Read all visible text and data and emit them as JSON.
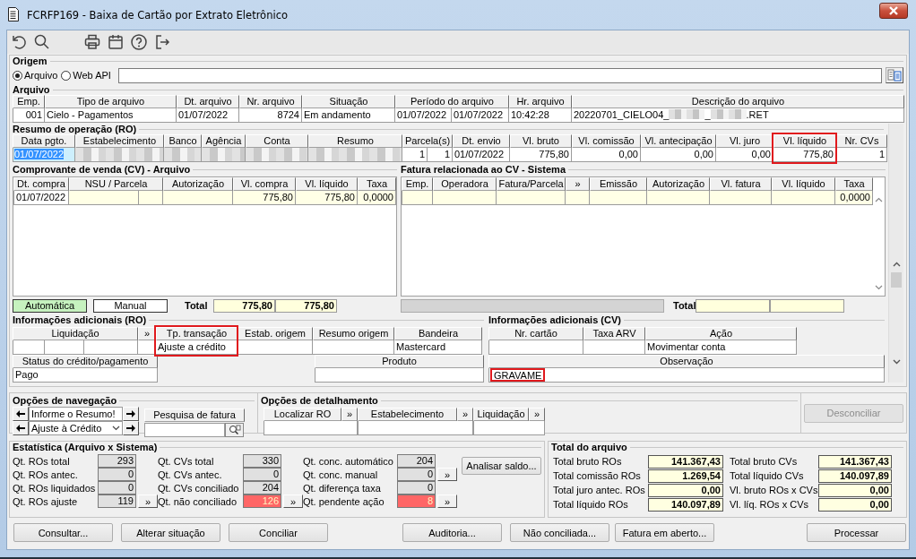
{
  "window": {
    "title": "FCRFP169 - Baixa de Cartão por Extrato Eletrônico"
  },
  "origem": {
    "title": "Origem",
    "options": [
      {
        "label": "Arquivo",
        "selected": true
      },
      {
        "label": "Web API",
        "selected": false
      }
    ]
  },
  "arquivo": {
    "title": "Arquivo",
    "columns": [
      {
        "label": "Emp."
      },
      {
        "label": "Tipo de arquivo"
      },
      {
        "label": "Dt. arquivo"
      },
      {
        "label": "Nr. arquivo"
      },
      {
        "label": "Situação"
      },
      {
        "label": "Período do arquivo"
      },
      {
        "label": "Hr. arquivo"
      },
      {
        "label": "Descrição do arquivo"
      }
    ],
    "rows": [
      [
        {
          "text": "001"
        },
        {
          "text": "Cielo - Pagamentos"
        },
        {
          "text": "01/07/2022"
        },
        {
          "text": "8724"
        },
        {
          "text": "Em andamento"
        },
        {
          "parts": [
            "01/07/2022",
            "01/07/2022"
          ]
        },
        {
          "text": "10:42:28"
        },
        {
          "segments": [
            {
              "text": "20220701_CIELO04_"
            },
            {
              "redacted": true
            },
            {
              "text": "_"
            },
            {
              "redacted": true
            },
            {
              "text": ".RET"
            }
          ]
        }
      ]
    ]
  },
  "resumo": {
    "title": "Resumo de operação (RO)",
    "columns": [
      {
        "label": "Data pgto.",
        "highlighted": false
      },
      {
        "label": "Estabelecimento",
        "highlighted": false
      },
      {
        "label": "Banco",
        "highlighted": false
      },
      {
        "label": "Agência",
        "highlighted": false
      },
      {
        "label": "Conta",
        "highlighted": false
      },
      {
        "label": "Resumo",
        "highlighted": false
      },
      {
        "label": "Parcela(s)",
        "highlighted": false
      },
      {
        "label": "Dt. envio",
        "highlighted": false
      },
      {
        "label": "Vl. bruto",
        "highlighted": false
      },
      {
        "label": "Vl. comissão",
        "highlighted": false
      },
      {
        "label": "Vl. antecipação",
        "highlighted": false
      },
      {
        "label": "Vl. juro",
        "highlighted": false
      },
      {
        "label": "Vl. líquido",
        "highlighted": true
      },
      {
        "label": "Nr. CVs",
        "highlighted": false
      }
    ],
    "rows": [
      [
        {
          "text": "01/07/2022",
          "selected": true
        },
        {
          "redacted": true
        },
        {
          "redacted": true
        },
        {
          "redacted": true
        },
        {
          "redacted": true
        },
        {
          "redacted": true
        },
        {
          "parts": [
            "1",
            "1"
          ]
        },
        {
          "text": "01/07/2022"
        },
        {
          "text": "775,80"
        },
        {
          "text": "0,00"
        },
        {
          "text": "0,00"
        },
        {
          "text": "0,00"
        },
        {
          "text": "775,80"
        },
        {
          "text": "1"
        }
      ]
    ]
  },
  "comprovante": {
    "title": "Comprovante de venda (CV) - Arquivo",
    "columns": [
      {
        "label": "Dt. compra"
      },
      {
        "label": "NSU / Parcela"
      },
      {
        "label": "Autorização"
      },
      {
        "label": "Vl. compra"
      },
      {
        "label": "Vl. líquido"
      },
      {
        "label": "Taxa"
      }
    ],
    "rows": [
      [
        {
          "text": "01/07/2022"
        },
        null,
        null,
        {
          "text": "775,80"
        },
        {
          "text": "775,80"
        },
        {
          "text": "0,0000"
        }
      ]
    ],
    "legend": [
      {
        "label": "Automática",
        "color": "#c6f2bf"
      },
      {
        "label": "Manual",
        "color": "#ffffff"
      }
    ],
    "total_label": "Total",
    "totals": [
      "775,80",
      "775,80"
    ]
  },
  "fatura": {
    "title": "Fatura relacionada ao CV - Sistema",
    "columns": [
      {
        "label": "Emp."
      },
      {
        "label": "Operadora"
      },
      {
        "label": "Fatura/Parcela"
      },
      {
        "label": "»"
      },
      {
        "label": "Emissão"
      },
      {
        "label": "Autorização"
      },
      {
        "label": "Vl. fatura"
      },
      {
        "label": "Vl. líquido"
      },
      {
        "label": "Taxa"
      }
    ],
    "rows": [
      [
        null,
        null,
        null,
        null,
        null,
        null,
        null,
        null,
        {
          "text": "0,0000"
        }
      ]
    ],
    "progress": {
      "level": 0
    },
    "total_label": "Total"
  },
  "info_ro": {
    "title": "Informações adicionais (RO)",
    "columns": [
      {
        "label": "Liquidação",
        "highlighted": false
      },
      {
        "label": "»",
        "highlighted": false
      },
      {
        "label": "Tp. transação",
        "highlighted": true
      },
      {
        "label": "Estab. origem",
        "highlighted": false
      },
      {
        "label": "Resumo origem",
        "highlighted": false
      },
      {
        "label": "Bandeira",
        "highlighted": false
      }
    ],
    "rows": [
      [
        null,
        null,
        {
          "text": "Ajuste a crédito"
        },
        null,
        null,
        {
          "text": "Mastercard"
        }
      ]
    ],
    "status": {
      "label": "Status do crédito/pagamento",
      "value": "Pago"
    },
    "produto": {
      "label": "Produto"
    }
  },
  "info_cv": {
    "title": "Informações adicionais (CV)",
    "columns": [
      {
        "label": "Nr. cartão"
      },
      {
        "label": "Taxa ARV"
      },
      {
        "label": "Ação"
      }
    ],
    "rows": [
      [
        null,
        null,
        {
          "text": "Movimentar conta"
        }
      ]
    ],
    "observacao": {
      "label": "Observação",
      "value": "GRAVAME",
      "highlighted": true
    }
  },
  "navegacao": {
    "title": "Opções de navegação",
    "resumo_field": "Informe o Resumo!",
    "filtro": "Ajuste à Crédito",
    "pesquisa_label": "Pesquisa de fatura"
  },
  "detalhamento": {
    "title": "Opções de detalhamento",
    "items": [
      {
        "label": "Localizar RO",
        "action": "»"
      },
      {
        "label": "Estabelecimento",
        "action": "»"
      },
      {
        "label": "Liquidação",
        "action": "»"
      }
    ]
  },
  "desconciliar": {
    "label": "Desconciliar",
    "disabled": true
  },
  "estatistica": {
    "title": "Estatística (Arquivo x Sistema)",
    "columns": [
      [
        {
          "label": "Qt. ROs total",
          "value": "293",
          "alert": false
        },
        {
          "label": "Qt. ROs antec.",
          "value": "0",
          "alert": false
        },
        {
          "label": "Qt. ROs liquidados",
          "value": "0",
          "alert": false
        },
        {
          "label": "Qt. ROs ajuste",
          "value": "119",
          "alert": false,
          "action": "»"
        }
      ],
      [
        {
          "label": "Qt. CVs total",
          "value": "330",
          "alert": false
        },
        {
          "label": "Qt. CVs antec.",
          "value": "0",
          "alert": false
        },
        {
          "label": "Qt. CVs conciliado",
          "value": "204",
          "alert": false
        },
        {
          "label": "Qt. não conciliado",
          "value": "126",
          "alert": true,
          "action": "»"
        }
      ],
      [
        {
          "label": "Qt. conc. automático",
          "value": "204",
          "alert": false
        },
        {
          "label": "Qt. conc. manual",
          "value": "0",
          "alert": false,
          "action": "»"
        },
        {
          "label": "Qt. diferença taxa",
          "value": "0",
          "alert": false
        },
        {
          "label": "Qt. pendente ação",
          "value": "8",
          "alert": true,
          "action": "»"
        }
      ]
    ],
    "analisar": "Analisar saldo..."
  },
  "total_arquivo": {
    "title": "Total do arquivo",
    "items": [
      {
        "label": "Total bruto ROs",
        "value": "141.367,43"
      },
      {
        "label": "Total bruto CVs",
        "value": "141.367,43"
      },
      {
        "label": "Total comissão ROs",
        "value": "1.269,54"
      },
      {
        "label": "Total líquido CVs",
        "value": "140.097,89"
      },
      {
        "label": "Total juro antec. ROs",
        "value": "0,00"
      },
      {
        "label": "Vl. bruto ROs x CVs",
        "value": "0,00"
      },
      {
        "label": "Total líquido ROs",
        "value": "140.097,89"
      },
      {
        "label": "Vl. líq. ROs x CVs",
        "value": "0,00"
      }
    ]
  },
  "buttons": [
    {
      "label": "Consultar..."
    },
    {
      "label": "Alterar situação"
    },
    {
      "label": "Conciliar"
    },
    {
      "label": "Auditoria..."
    },
    {
      "label": "Não conciliada..."
    },
    {
      "label": "Fatura em aberto..."
    },
    {
      "label": "Processar"
    }
  ]
}
